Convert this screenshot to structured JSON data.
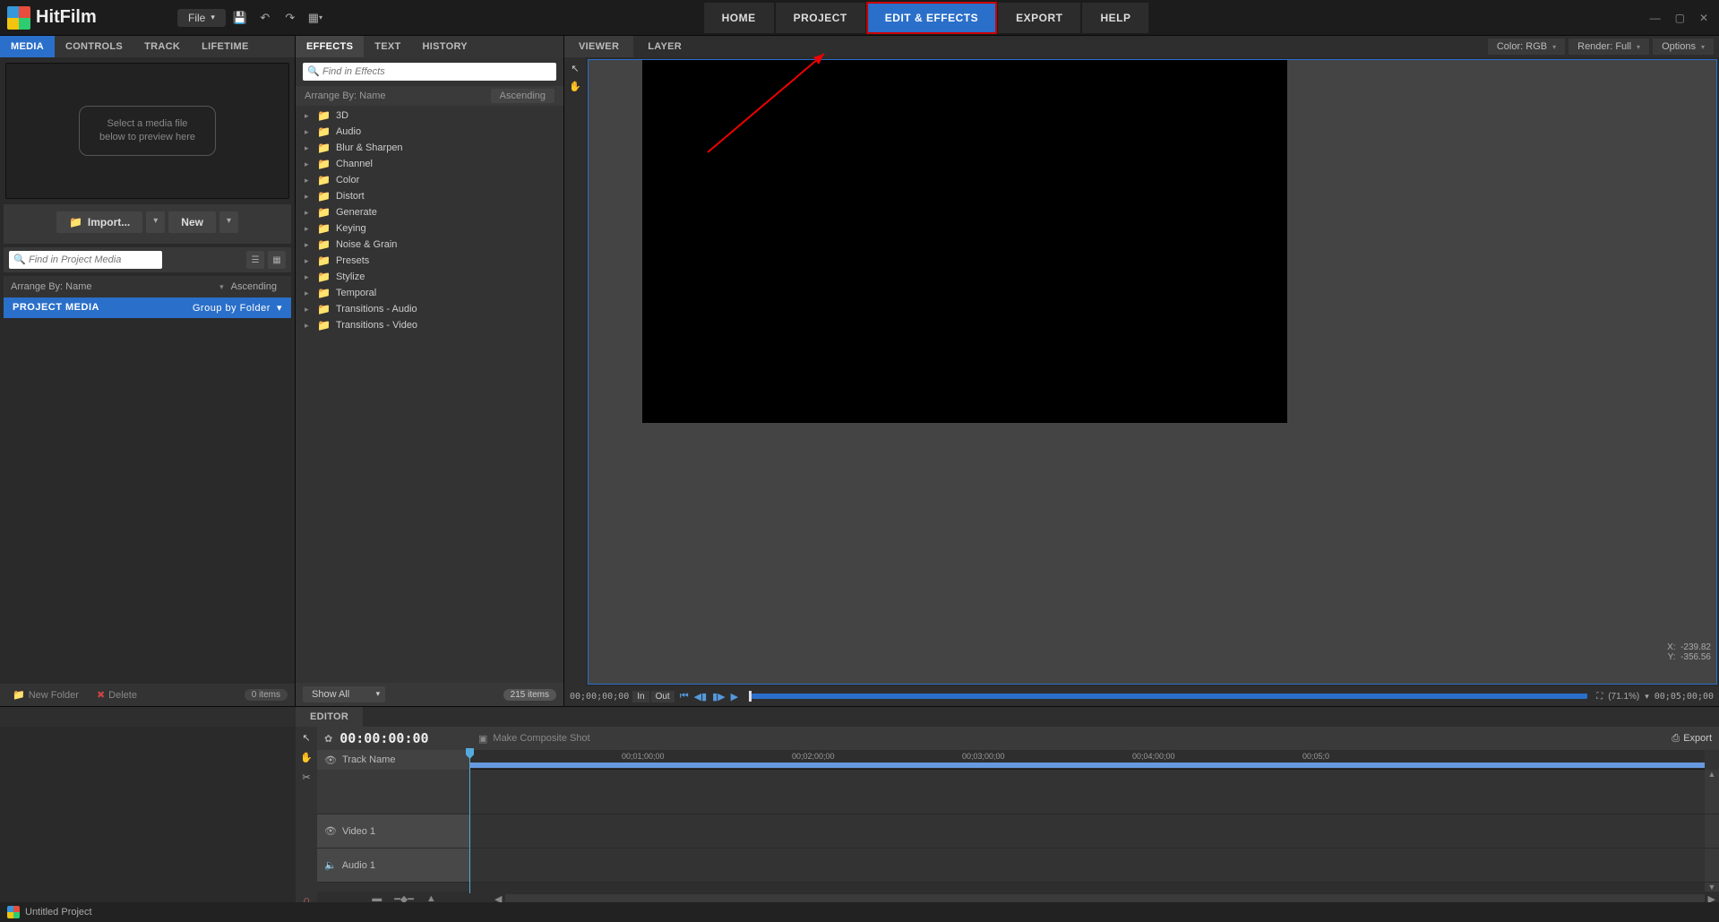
{
  "app": {
    "name": "HitFilm"
  },
  "titlebar": {
    "file_label": "File"
  },
  "nav": {
    "home": "HOME",
    "project": "PROJECT",
    "edit_effects": "EDIT & EFFECTS",
    "export": "EXPORT",
    "help": "HELP"
  },
  "media_panel": {
    "tabs": {
      "media": "MEDIA",
      "controls": "CONTROLS",
      "track": "TRACK",
      "lifetime": "LIFETIME"
    },
    "preview_msg_l1": "Select a media file",
    "preview_msg_l2": "below to preview here",
    "import_label": "Import...",
    "new_label": "New",
    "search_placeholder": "Find in Project Media",
    "arrange_label": "Arrange By: Name",
    "ascending": "Ascending",
    "project_media": "PROJECT MEDIA",
    "group_by": "Group by Folder",
    "new_folder": "New Folder",
    "delete": "Delete",
    "item_count": "0 items"
  },
  "effects_panel": {
    "tabs": {
      "effects": "EFFECTS",
      "text": "TEXT",
      "history": "HISTORY"
    },
    "search_placeholder": "Find in Effects",
    "arrange_label": "Arrange By: Name",
    "ascending": "Ascending",
    "categories": [
      "3D",
      "Audio",
      "Blur & Sharpen",
      "Channel",
      "Color",
      "Distort",
      "Generate",
      "Keying",
      "Noise & Grain",
      "Presets",
      "Stylize",
      "Temporal",
      "Transitions - Audio",
      "Transitions - Video"
    ],
    "show_all": "Show All",
    "item_count": "215 items"
  },
  "viewer": {
    "tabs": {
      "viewer": "VIEWER",
      "layer": "LAYER"
    },
    "color_mode": "Color: RGB",
    "render_mode": "Render: Full",
    "options": "Options",
    "coord_x_label": "X:",
    "coord_x": "-239.82",
    "coord_y_label": "Y:",
    "coord_y": "-356.56",
    "timecode": "00;00;00;00",
    "in_label": "In",
    "out_label": "Out",
    "zoom": "(71.1%)",
    "duration": "00;05;00;00"
  },
  "editor": {
    "tab": "EDITOR",
    "timecode": "00:00:00:00",
    "make_composite": "Make Composite Shot",
    "export": "Export",
    "track_name_label": "Track Name",
    "video1": "Video 1",
    "audio1": "Audio 1",
    "ruler_marks": [
      "00;01;00;00",
      "00;02;00;00",
      "00;03;00;00",
      "00;04;00;00",
      "00;05;0"
    ]
  },
  "status": {
    "project": "Untitled Project"
  }
}
